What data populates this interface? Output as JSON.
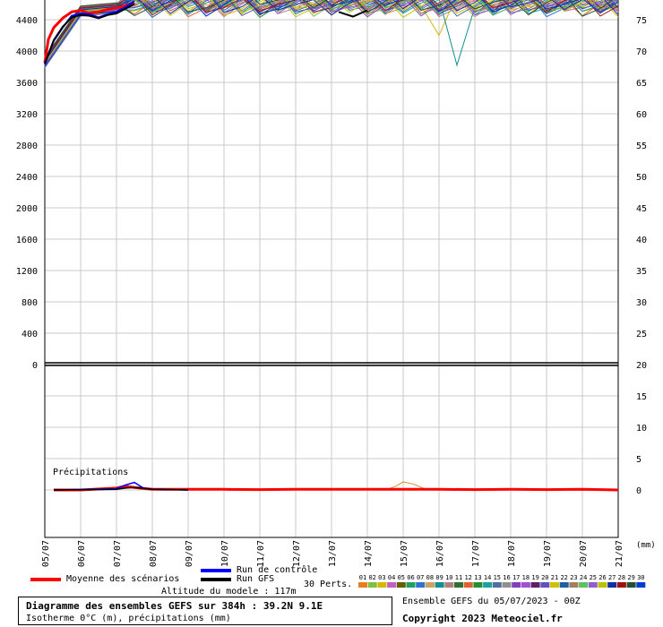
{
  "chart_data": {
    "type": "line",
    "left_axis": {
      "ticks": [
        "4400",
        "4000",
        "3600",
        "3200",
        "2800",
        "2400",
        "2000",
        "1600",
        "1200",
        "800",
        "400",
        "0"
      ],
      "range": [
        0,
        4800
      ]
    },
    "right_axis": {
      "ticks": [
        "75",
        "70",
        "65",
        "60",
        "55",
        "50",
        "45",
        "40",
        "35",
        "30",
        "25",
        "20",
        "15",
        "10",
        "5",
        "0"
      ],
      "range": [
        0,
        80
      ]
    },
    "right_unit": "(mm)",
    "x_ticks": [
      "05/07",
      "06/07",
      "07/07",
      "08/07",
      "09/07",
      "10/07",
      "11/07",
      "12/07",
      "13/07",
      "14/07",
      "15/07",
      "16/07",
      "17/07",
      "18/07",
      "19/07",
      "20/07",
      "21/07"
    ],
    "precip_label": "Précipitations",
    "series": [
      {
        "name": "Moyenne des scénarios",
        "color": "#ff0000",
        "iso_x": [
          0,
          0.1,
          0.25,
          0.5,
          0.75,
          1.0,
          1.25,
          1.5,
          1.75,
          2.0,
          2.25,
          2.5
        ],
        "iso_y": [
          3850,
          4150,
          4300,
          4420,
          4500,
          4520,
          4480,
          4500,
          4530,
          4550,
          4580,
          4620
        ],
        "precip_x": [
          0.25,
          1,
          2,
          2.25,
          2.5,
          3,
          4,
          5,
          6,
          7,
          8,
          9,
          10,
          11,
          12,
          13,
          14,
          15,
          16
        ],
        "precip_y": [
          0,
          0,
          0.3,
          0.6,
          0.4,
          0.1,
          0.1,
          0.1,
          0.05,
          0.1,
          0.1,
          0.1,
          0.1,
          0.1,
          0.05,
          0.1,
          0.05,
          0.1,
          0
        ]
      },
      {
        "name": "Run de contrôle",
        "color": "#0000ff",
        "iso_x": [
          0,
          0.25,
          0.5,
          0.75,
          1.0,
          1.25,
          1.5,
          1.75,
          2.0,
          2.25,
          2.5
        ],
        "iso_y": [
          3830,
          4130,
          4300,
          4450,
          4480,
          4470,
          4430,
          4470,
          4500,
          4560,
          4640
        ],
        "precip_x": [
          0.25,
          2,
          2.25,
          2.5,
          2.75,
          3,
          4
        ],
        "precip_y": [
          0,
          0.2,
          0.8,
          1.2,
          0.3,
          0.1,
          0
        ]
      },
      {
        "name": "Run GFS",
        "color": "#000000",
        "iso_x": [
          0,
          0.25,
          0.5,
          0.75,
          1.0,
          1.25,
          1.5,
          1.75,
          2.0,
          2.25,
          2.5,
          8.2,
          8.4,
          8.6,
          8.8,
          9.0
        ],
        "iso_y": [
          3840,
          4140,
          4310,
          4430,
          4460,
          4450,
          4420,
          4460,
          4480,
          4540,
          4600,
          4500,
          4470,
          4440,
          4480,
          4520
        ],
        "precip_x": [
          0.25,
          2,
          2.25,
          2.5,
          3,
          4
        ],
        "precip_y": [
          0,
          0.1,
          0.3,
          0.4,
          0.1,
          0
        ]
      }
    ],
    "perturbations": {
      "label": "30 Perts.",
      "numbers": [
        "01",
        "02",
        "03",
        "04",
        "05",
        "06",
        "07",
        "08",
        "09",
        "10",
        "11",
        "12",
        "13",
        "14",
        "15",
        "16",
        "17",
        "18",
        "19",
        "20",
        "21",
        "22",
        "23",
        "24",
        "25",
        "26",
        "27",
        "28",
        "29",
        "30"
      ],
      "colors": [
        "#e67e22",
        "#7fbf3f",
        "#d4b800",
        "#c060c0",
        "#606000",
        "#20a060",
        "#3070d0",
        "#d0a060",
        "#109090",
        "#b08080",
        "#307030",
        "#e06030",
        "#209030",
        "#20a0a0",
        "#5070a0",
        "#909090",
        "#8040c0",
        "#a050d0",
        "#602060",
        "#6050c0",
        "#d0c000",
        "#2060a0",
        "#a08060",
        "#60c060",
        "#9060d0",
        "#c0c000",
        "#1030a0",
        "#a01010",
        "#205030",
        "#0040d0"
      ]
    },
    "altitude_label": "Altitude du modele : 117m",
    "title": "Diagramme des ensembles GEFS sur 384h : 39.2N 9.1E",
    "subtitle": "Isotherme 0°C (m), précipitations (mm)"
  },
  "footer": {
    "ensemble_run": "Ensemble GEFS du 05/07/2023 - 00Z",
    "copyright": "Copyright 2023 Meteociel.fr"
  }
}
